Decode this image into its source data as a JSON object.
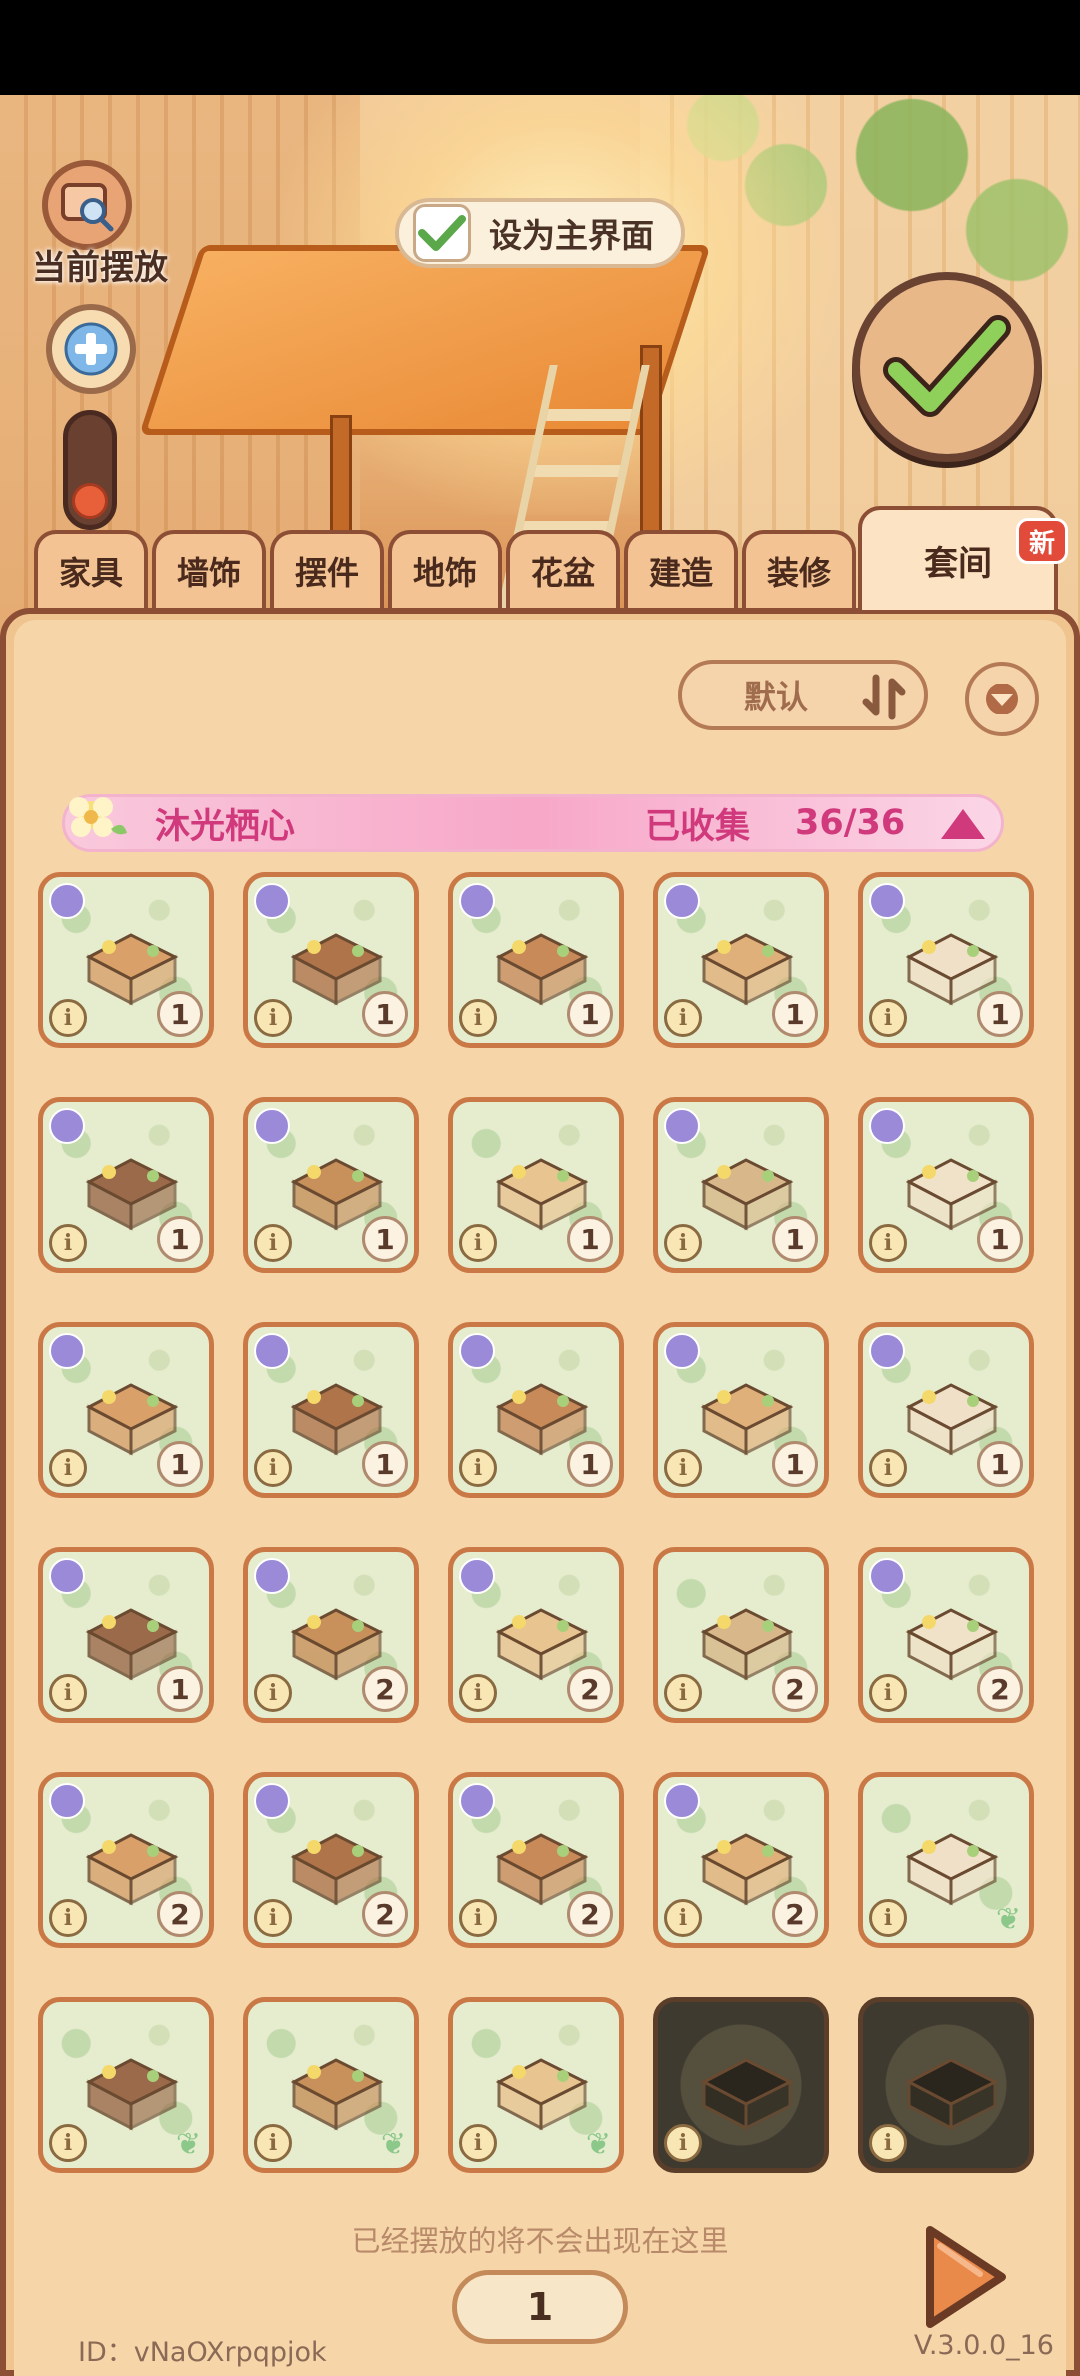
{
  "hud": {
    "current_label": "当前摆放",
    "set_main_label": "设为主界面"
  },
  "tabs": [
    {
      "label": "家具"
    },
    {
      "label": "墙饰"
    },
    {
      "label": "摆件"
    },
    {
      "label": "地饰"
    },
    {
      "label": "花盆"
    },
    {
      "label": "建造"
    },
    {
      "label": "装修"
    },
    {
      "label": "套间",
      "active": true
    }
  ],
  "new_badge": "新",
  "sort": {
    "label": "默认"
  },
  "set_bar": {
    "name": "沐光栖心",
    "collected_label": "已收集",
    "collected_count": "36/36"
  },
  "items": [
    {
      "qty": "1",
      "kind": "sofa",
      "badge": true
    },
    {
      "qty": "1",
      "kind": "desk-shelf",
      "badge": true
    },
    {
      "qty": "1",
      "kind": "bookshelf",
      "badge": true
    },
    {
      "qty": "1",
      "kind": "bed",
      "badge": true
    },
    {
      "qty": "1",
      "kind": "chair",
      "badge": true
    },
    {
      "qty": "1",
      "kind": "stool",
      "badge": true
    },
    {
      "qty": "1",
      "kind": "cabinet",
      "badge": true
    },
    {
      "qty": "1",
      "kind": "rug",
      "badge": false
    },
    {
      "qty": "1",
      "kind": "canopy",
      "badge": true
    },
    {
      "qty": "1",
      "kind": "fridge",
      "badge": true
    },
    {
      "qty": "1",
      "kind": "round-table",
      "badge": true
    },
    {
      "qty": "1",
      "kind": "door",
      "badge": true
    },
    {
      "qty": "1",
      "kind": "lamp",
      "badge": true
    },
    {
      "qty": "1",
      "kind": "window",
      "badge": true
    },
    {
      "qty": "1",
      "kind": "vanity",
      "badge": true
    },
    {
      "qty": "1",
      "kind": "corner-shelf",
      "badge": true
    },
    {
      "qty": "2",
      "kind": "flower-bush",
      "badge": true
    },
    {
      "qty": "2",
      "kind": "tv-stand",
      "badge": true
    },
    {
      "qty": "2",
      "kind": "curtain",
      "badge": false
    },
    {
      "qty": "2",
      "kind": "counter",
      "badge": true
    },
    {
      "qty": "2",
      "kind": "arch",
      "badge": true
    },
    {
      "qty": "2",
      "kind": "planter-table",
      "badge": true
    },
    {
      "qty": "2",
      "kind": "kitchen",
      "badge": true
    },
    {
      "qty": "2",
      "kind": "bed-canopy",
      "badge": true
    },
    {
      "qty": "",
      "kind": "wallpaper",
      "badge": false
    },
    {
      "qty": "",
      "kind": "floor-wood",
      "badge": false
    },
    {
      "qty": "",
      "kind": "wall-panel",
      "badge": false
    },
    {
      "qty": "",
      "kind": "floor-green",
      "badge": false
    },
    {
      "qty": "",
      "kind": "gate-dark",
      "badge": false,
      "dark": true
    },
    {
      "qty": "",
      "kind": "fence-dark",
      "badge": false,
      "dark": true
    }
  ],
  "hint": "已经摆放的将不会出现在这里",
  "page": "1",
  "footer": {
    "id": "ID：vNaOXrpqpjok",
    "version": "V.3.0.0_16"
  },
  "colors": {
    "panel": "#f0c48f",
    "border": "#8c4e34",
    "set_pink": "#d03a7c",
    "tile_border": "#c97846"
  }
}
